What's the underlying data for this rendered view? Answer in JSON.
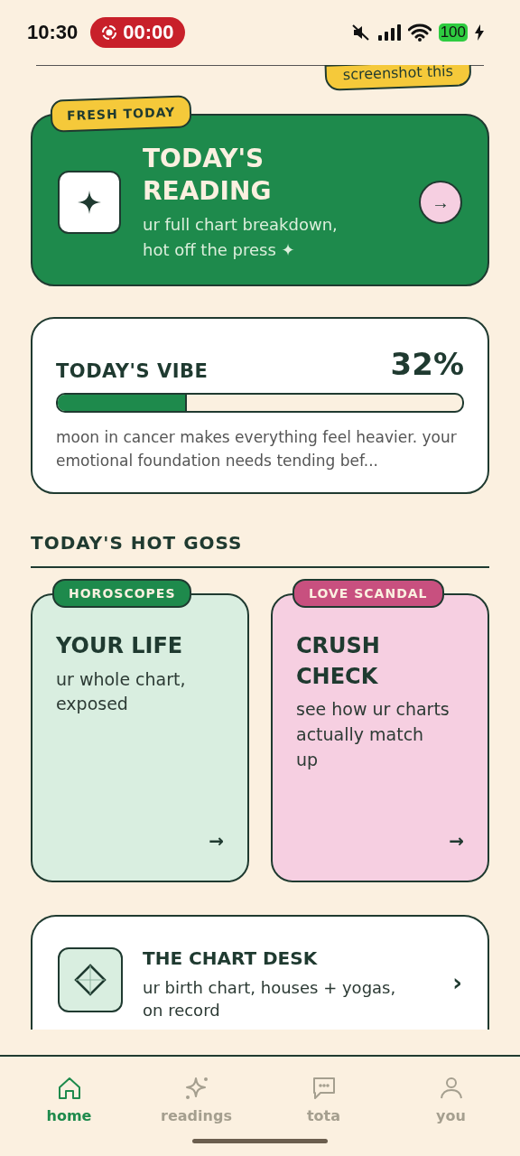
{
  "status_bar": {
    "time": "10:30",
    "recording": "00:00",
    "battery": "100"
  },
  "sticker": {
    "label": "screenshot this"
  },
  "featured": {
    "tag": "FRESH TODAY",
    "title": "TODAY'S READING",
    "subtitle": "ur full chart breakdown, hot off the press ✦",
    "arrow": "→"
  },
  "vibe": {
    "title": "TODAY'S VIBE",
    "percent": "32%",
    "level": 0.32,
    "text": "moon in cancer makes everything feel heavier. your emotional foundation needs tending bef..."
  },
  "section": {
    "title": "TODAY'S HOT GOSS"
  },
  "goss_cards": [
    {
      "tag": "HOROSCOPES",
      "title": "YOUR LIFE",
      "text": "ur whole chart, exposed",
      "arrow": "→",
      "kind": "mint",
      "color": "#1e8a4c"
    },
    {
      "tag": "LOVE SCANDAL",
      "title": "CRUSH CHECK",
      "text": "see how ur charts actually match up",
      "arrow": "→",
      "kind": "pink",
      "color": "#c8507f"
    }
  ],
  "desk": {
    "title": "THE CHART DESK",
    "text": "ur birth chart, houses + yogas, on record",
    "chevron": "›"
  },
  "nav": [
    {
      "label": "home",
      "kind": "home",
      "selected": true
    },
    {
      "label": "readings",
      "kind": "sparkle",
      "selected": false
    },
    {
      "label": "tota",
      "kind": "chat",
      "selected": false
    },
    {
      "label": "you",
      "kind": "person",
      "selected": false
    }
  ]
}
